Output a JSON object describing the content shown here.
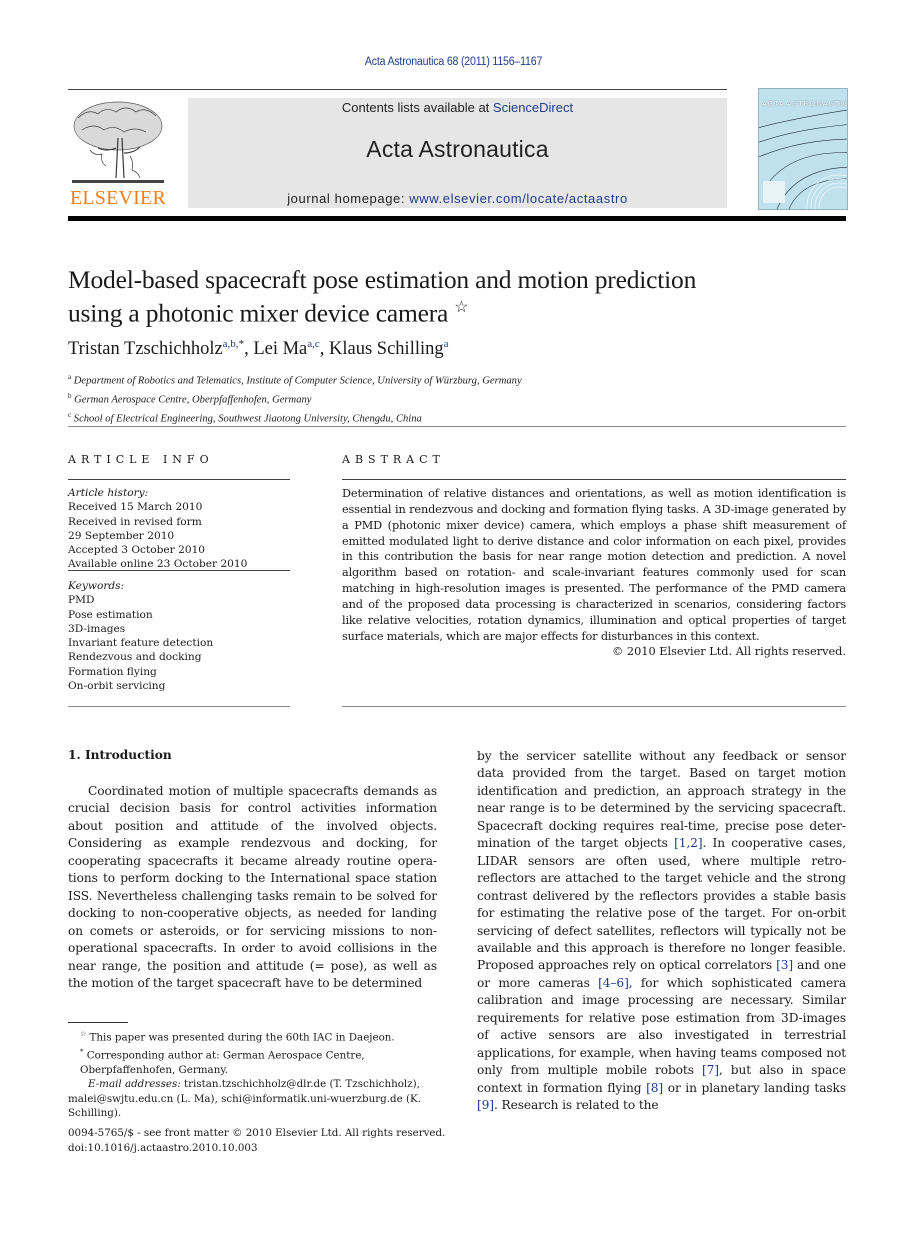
{
  "header": {
    "citation": "Acta Astronautica 68 (2011) 1156–1167",
    "publisher_logo_text": "ELSEVIER",
    "contents_prefix": "Contents lists available at ",
    "contents_link": "ScienceDirect",
    "journal_title": "Acta Astronautica",
    "homepage_prefix": "journal homepage: ",
    "homepage_link": "www.elsevier.com/locate/actaastro",
    "cover_title": "ACTA ASTRONAUTICA"
  },
  "article": {
    "title_line1": "Model-based spacecraft pose estimation and motion prediction",
    "title_line2": "using a photonic mixer device camera",
    "title_note_mark": "☆",
    "authors": [
      {
        "name": "Tristan Tzschichholz",
        "sup": "a,b,",
        "mark": "*",
        "sep": ", "
      },
      {
        "name": "Lei Ma",
        "sup": "a,c",
        "mark": "",
        "sep": ", "
      },
      {
        "name": "Klaus Schilling",
        "sup": "a",
        "mark": "",
        "sep": ""
      }
    ],
    "affiliations": [
      {
        "key": "a",
        "text": "Department of Robotics and Telematics, Institute of Computer Science, University of Würzburg, Germany"
      },
      {
        "key": "b",
        "text": "German Aerospace Centre, Oberpfaffenhofen, Germany"
      },
      {
        "key": "c",
        "text": "School of Electrical Engineering, Southwest Jiaotong University, Chengdu, China"
      }
    ]
  },
  "article_info": {
    "heading": "ARTICLE INFO",
    "history_label": "Article history:",
    "history": [
      "Received 15 March 2010",
      "Received in revised form",
      "29 September 2010",
      "Accepted 3 October 2010",
      "Available online 23 October 2010"
    ],
    "keywords_label": "Keywords:",
    "keywords": [
      "PMD",
      "Pose estimation",
      "3D-images",
      "Invariant feature detection",
      "Rendezvous and docking",
      "Formation flying",
      "On-orbit servicing"
    ]
  },
  "abstract": {
    "heading": "ABSTRACT",
    "text": "Determination of relative distances and orientations, as well as motion identification is essential in rendezvous and docking and formation flying tasks. A 3D-image generated by a PMD (photonic mixer device) camera, which employs a phase shift measurement of emitted modulated light to derive distance and color information on each pixel, provides in this contribution the basis for near range motion detection and prediction. A novel algorithm based on rotation- and scale-invariant features commonly used for scan matching in high-resolution images is presented. The performance of the PMD camera and of the proposed data processing is characterized in scenarios, considering factors like relative velocities, rotation dynamics, illumination and optical properties of target surface materials, which are major effects for disturbances in this context.",
    "copyright": "© 2010 Elsevier Ltd. All rights reserved."
  },
  "body": {
    "section_heading": "1.  Introduction",
    "left_paragraph": "Coordinated motion of multiple spacecrafts demands as crucial decision basis for control activities information about position and attitude of the involved objects. Considering as example rendezvous and docking, for cooperating spacecrafts it became already routine opera­tions to perform docking to the International space station ISS. Nevertheless challenging tasks remain to be solved for docking to non-cooperative objects, as needed for landing on comets or asteroids, or for servicing missions to non-operational spacecrafts. In order to avoid collisions in the near range, the position and attitude (= pose), as well as the motion of the target spacecraft have to be determined",
    "right_segments": [
      {
        "t": "by the servicer satellite without any feedback or sensor data provided from the target. Based on target motion identification and prediction, an approach strategy in the near range is to be determined by the servicing spacecraft. Spacecraft docking requires real-time, precise pose deter­mination of the target objects ",
        "ref": false
      },
      {
        "t": "[1,2]",
        "ref": true
      },
      {
        "t": ". In cooperative cases, LIDAR sensors are often used, where multiple retro-reflectors are attached to the target vehicle and the strong contrast delivered by the reflectors provides a stable basis for estimating the relative pose of the target. For on-orbit servicing of defect satellites, reflectors will typically not be available and this approach is therefore no longer feasible. Proposed approaches rely on optical correlators ",
        "ref": false
      },
      {
        "t": "[3]",
        "ref": true
      },
      {
        "t": " and one or more cameras ",
        "ref": false
      },
      {
        "t": "[4–6]",
        "ref": true
      },
      {
        "t": ", for which sophisti­cated camera calibration and image processing are necessary. Similar requirements for relative pose estima­tion from 3D-images of active sensors are also investi­gated in terrestrial applications, for example, when having teams composed not only from multiple mobile robots ",
        "ref": false
      },
      {
        "t": "[7]",
        "ref": true
      },
      {
        "t": ", but also in space context in formation flying ",
        "ref": false
      },
      {
        "t": "[8]",
        "ref": true
      },
      {
        "t": " or in planetary landing tasks ",
        "ref": false
      },
      {
        "t": "[9]",
        "ref": true
      },
      {
        "t": ". Research is related to the",
        "ref": false
      }
    ]
  },
  "footnotes": {
    "star_mark": "☆",
    "star_note": " This paper was presented during the 60th IAC in Daejeon.",
    "corr_mark": "*",
    "corr_note": " Corresponding author at: German Aerospace Centre, Oberpfaffenho­fen, Germany.",
    "email_label": "E-mail addresses:",
    "email_text": " tristan.tzschichholz@dlr.de (T. Tzschichholz), malei@swjtu.edu.cn (L. Ma), schi@informatik.uni-wuerzburg.de (K. Schilling).",
    "front_matter": "0094-5765/$ - see front matter © 2010 Elsevier Ltd. All rights reserved.",
    "doi": "doi:10.1016/j.actaastro.2010.10.003"
  }
}
